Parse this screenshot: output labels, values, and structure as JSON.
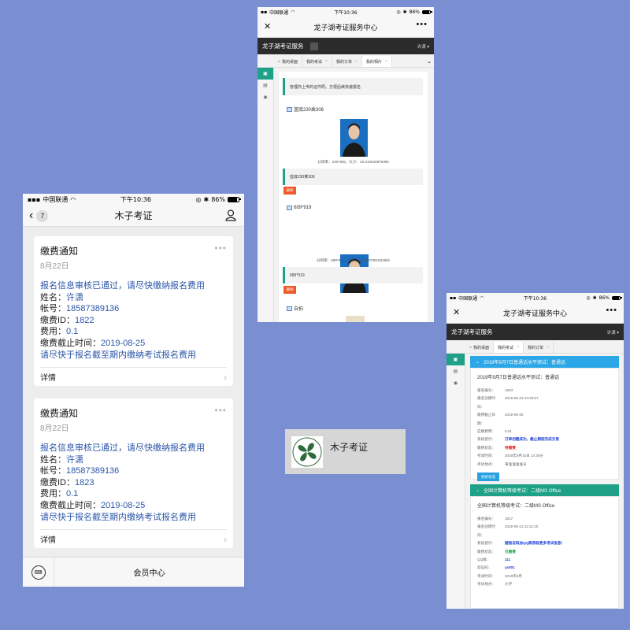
{
  "p1": {
    "status": {
      "carrier": "中国联通",
      "time": "下午10:36",
      "battery": "86%"
    },
    "nav": {
      "back_count": "7",
      "title": "木子考证"
    },
    "cards": [
      {
        "title": "缴费通知",
        "date": "8月22日",
        "intro": "报名信息审核已通过，请尽快缴纳报名费用",
        "name_label": "姓名：",
        "name": "许潇",
        "account_label": "帐号：",
        "account": "18587389136",
        "payid_label": "缴费ID：",
        "payid": "1822",
        "fee_label": "费用：",
        "fee": "0.1",
        "deadline_label": "缴费截止时间：",
        "deadline": "2019-08-25",
        "remark": "请尽快于报名截至期内缴纳考试报名费用",
        "detail": "详情"
      },
      {
        "title": "缴费通知",
        "date": "8月22日",
        "intro": "报名信息审核已通过，请尽快缴纳报名费用",
        "name_label": "姓名：",
        "name": "许潇",
        "account_label": "帐号：",
        "account": "18587389136",
        "payid_label": "缴费ID：",
        "payid": "1823",
        "fee_label": "费用：",
        "fee": "0.1",
        "deadline_label": "缴费截止时间：",
        "deadline": "2019-08-25",
        "remark": "请尽快于报名截至期内缴纳考试报名费用",
        "detail": "详情"
      }
    ],
    "bottom": {
      "keyboard": "⌨",
      "menu": "会员中心"
    }
  },
  "p2": {
    "status": {
      "carrier": "中国联通",
      "time": "下午10:36",
      "battery": "86%"
    },
    "nav": {
      "close": "✕",
      "title": "龙子湖考证服务中心",
      "more": "•••"
    },
    "app": {
      "brand": "龙子湖考证服务",
      "user": "许潇 ▾"
    },
    "tabs": [
      "我的桌面",
      "我的考试",
      "我的订单",
      "我的相片"
    ],
    "notice": "管理你上传的证件照。方便后续快速报名",
    "photos": [
      {
        "title": "蓝底230乘306",
        "meta": "分辨率：230*306，大小：49.3105468754kb",
        "caption": "蓝底230乘306",
        "delete": "删除"
      },
      {
        "title": "689*919",
        "meta": "分辨率：689*919，大小：168.5478515625kb",
        "caption": "689*919",
        "delete": "删除"
      }
    ],
    "last": "自拍"
  },
  "p3": {
    "status": {
      "carrier": "中国联通",
      "time": "下午10:36",
      "battery": "86%"
    },
    "nav": {
      "close": "✕",
      "title": "龙子湖考证服务中心",
      "more": "•••"
    },
    "app": {
      "brand": "龙子湖考证服务",
      "user": "许潇 ▾"
    },
    "tabs": [
      "我的桌面",
      "我的考试",
      "我的订单"
    ],
    "panels": [
      {
        "header": "2019年9月7日普通话水平测试：普通话",
        "subtitle": "2019年9月7日普通话水平测试：普通话",
        "rows": [
          {
            "k": "报名编号：",
            "v": "1823",
            "style": ""
          },
          {
            "k": "报名创建时间：",
            "v": "2019-08-22 23:29:57",
            "style": ""
          },
          {
            "k": "缴费截止日期：",
            "v": "2019-08-25",
            "style": ""
          },
          {
            "k": "应缴费用：",
            "v": "0.01",
            "style": ""
          },
          {
            "k": "系统提示：",
            "v": "订单创建成功，截止期前完成交易",
            "style": "blue"
          },
          {
            "k": "缴费状态：",
            "v": "待缴费",
            "style": "red"
          },
          {
            "k": "考试时间：",
            "v": "2019年9月15日 14:30分",
            "style": ""
          },
          {
            "k": "考试地点：",
            "v": "黄淮淮淮淮号",
            "style": ""
          }
        ],
        "button": "更新状态"
      },
      {
        "header": "全国计算机等级考试：二级MS Office",
        "subtitle": "全国计算机等级考试：二级MS Office",
        "rows": [
          {
            "k": "报名编号：",
            "v": "1817",
            "style": ""
          },
          {
            "k": "报名创建时间：",
            "v": "2019-08-21 22:11:20",
            "style": ""
          },
          {
            "k": "系统提示：",
            "v": "随验证码加QQ群获取更多考试信息！",
            "style": "blue"
          },
          {
            "k": "缴费状态：",
            "v": "已缴费",
            "style": "green"
          },
          {
            "k": "QQ群：",
            "v": "111",
            "style": "blue"
          },
          {
            "k": "验证码：",
            "v": "yx001",
            "style": "blue"
          },
          {
            "k": "考试时间：",
            "v": "2019年9月",
            "style": ""
          },
          {
            "k": "考试地点：",
            "v": "大学",
            "style": ""
          }
        ]
      }
    ]
  },
  "logo": {
    "name": "木子考证"
  },
  "colors": {
    "background": "#7a8fd2",
    "link_blue": "#2b56a8",
    "teal": "#1ea187",
    "panel_blue": "#2ba6e6",
    "delete_orange": "#f05a28"
  }
}
